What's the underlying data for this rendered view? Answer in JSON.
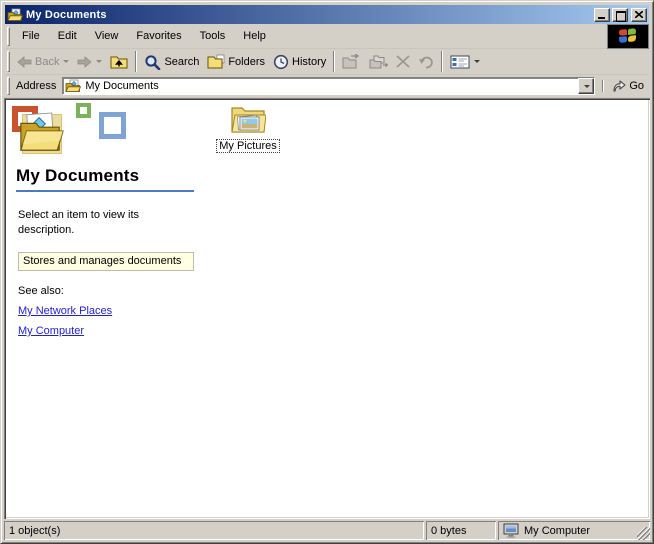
{
  "window": {
    "title": "My Documents"
  },
  "menubar": {
    "items": [
      "File",
      "Edit",
      "View",
      "Favorites",
      "Tools",
      "Help"
    ]
  },
  "toolbar": {
    "back_label": "Back",
    "search_label": "Search",
    "folders_label": "Folders",
    "history_label": "History"
  },
  "addressbar": {
    "label": "Address",
    "value": "My Documents",
    "go_label": "Go"
  },
  "sidebar": {
    "title": "My Documents",
    "description": "Select an item to view its description.",
    "infotip": "Stores and manages documents",
    "see_also_label": "See also:",
    "links": [
      {
        "label": "My Network Places"
      },
      {
        "label": "My Computer"
      }
    ]
  },
  "content": {
    "items": [
      {
        "label": "My Pictures"
      }
    ]
  },
  "statusbar": {
    "objects": "1 object(s)",
    "size": "0 bytes",
    "zone": "My Computer"
  },
  "colors": {
    "titlebar_gradient_start": "#0A246A",
    "titlebar_gradient_end": "#A6CAF0",
    "face": "#D4D0C8",
    "link": "#2222CC",
    "infotip_bg": "#FFFFE1",
    "heading_rule": "#4C7BBF"
  }
}
